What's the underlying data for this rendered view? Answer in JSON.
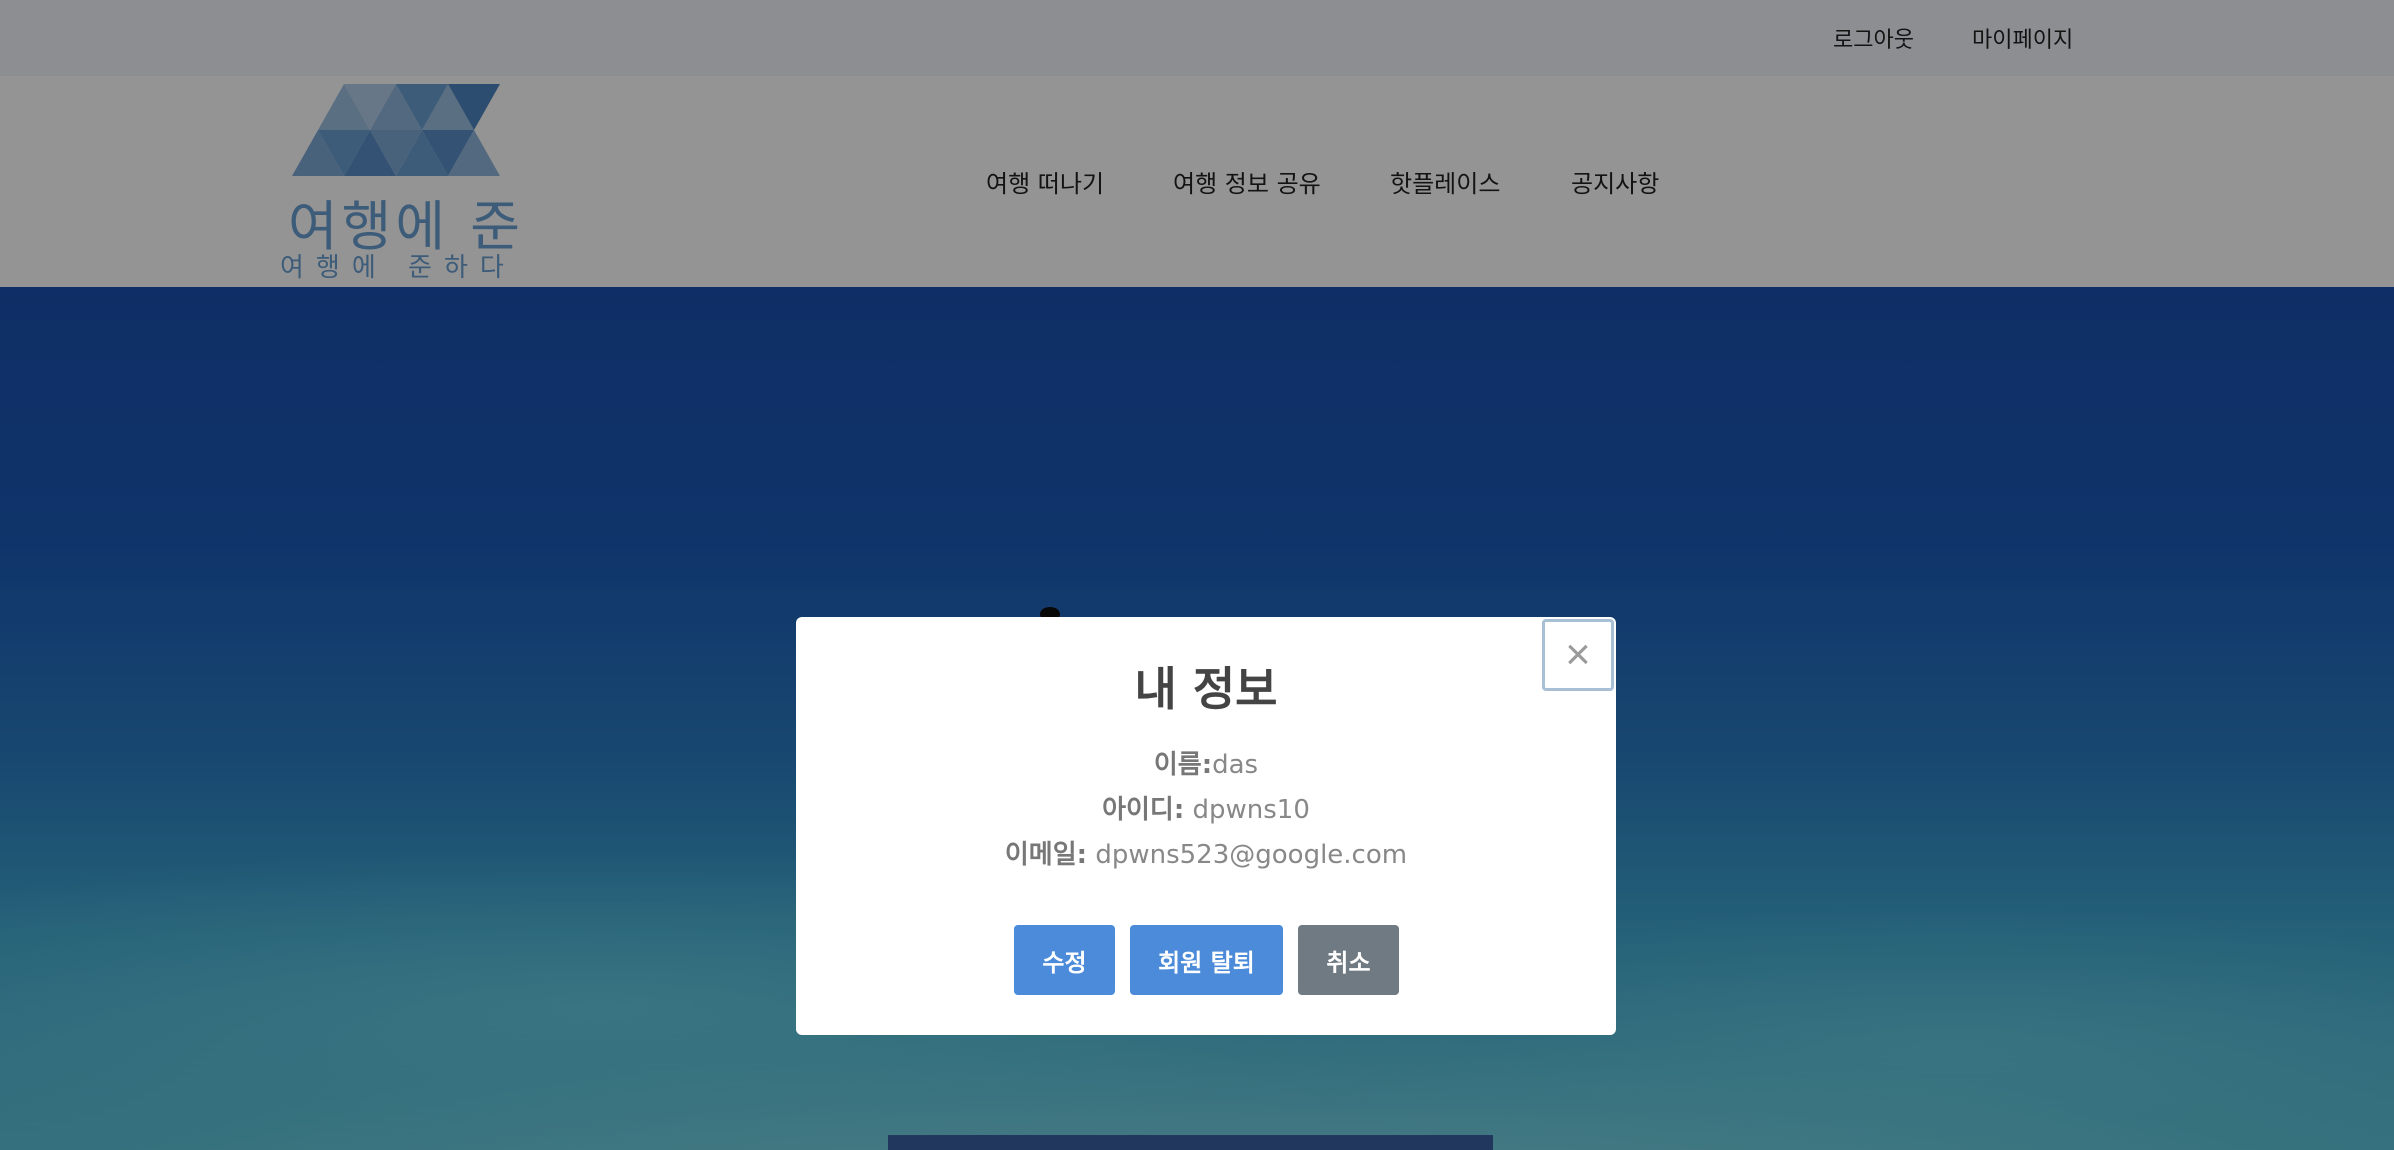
{
  "topbar": {
    "logout_label": "로그아웃",
    "mypage_label": "마이페이지"
  },
  "header": {
    "logo": {
      "title": "여행에 준",
      "subtitle": "여행에 준하다"
    },
    "nav": [
      {
        "label": "여행 떠나기"
      },
      {
        "label": "여행 정보 공유"
      },
      {
        "label": "핫플레이스"
      },
      {
        "label": "공지사항"
      }
    ]
  },
  "modal": {
    "title": "내 정보",
    "close_symbol": "×",
    "name_label": "이름:",
    "name_value": "das",
    "id_label": "아이디:",
    "id_value": " dpwns10",
    "email_label": "이메일:",
    "email_value": " dpwns523@google.com",
    "edit_label": "수정",
    "withdraw_label": "회원 탈퇴",
    "cancel_label": "취소"
  },
  "colors": {
    "primary_button": "#4b8bd9",
    "secondary_button": "#6f7a83",
    "logo_blue": "#6a9fd0"
  }
}
